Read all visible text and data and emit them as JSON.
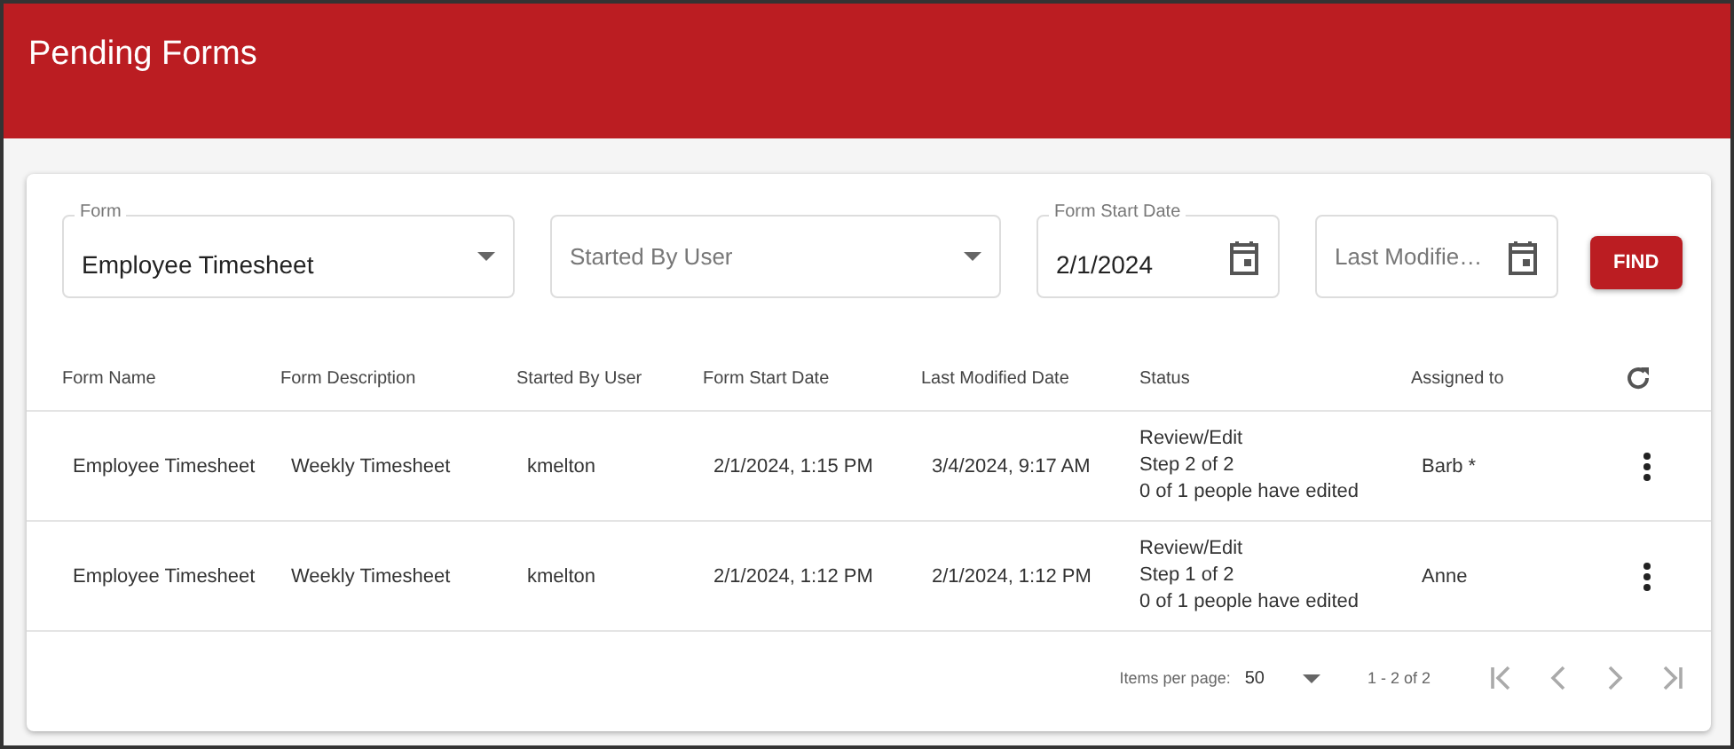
{
  "header": {
    "title": "Pending Forms"
  },
  "filters": [
    {
      "kind": "select",
      "label": "Form",
      "value": "Employee Timesheet"
    },
    {
      "kind": "select",
      "placeholder": "Started By User"
    },
    {
      "kind": "date",
      "label": "Form Start Date",
      "value": "2/1/2024"
    },
    {
      "kind": "date",
      "placeholder": "Last Modifie…"
    }
  ],
  "find_button": "FIND",
  "table": {
    "columns": [
      "Form Name",
      "Form Description",
      "Started By User",
      "Form Start Date",
      "Last Modified Date",
      "Status",
      "Assigned to"
    ],
    "rows": [
      {
        "cells": [
          "Employee Timesheet",
          "Weekly Timesheet",
          "kmelton",
          "2/1/2024, 1:15 PM",
          "3/4/2024, 9:17 AM"
        ],
        "status": [
          "Review/Edit",
          "Step 2 of 2",
          "0 of 1 people have edited"
        ],
        "assigned": "Barb *"
      },
      {
        "cells": [
          "Employee Timesheet",
          "Weekly Timesheet",
          "kmelton",
          "2/1/2024, 1:12 PM",
          "2/1/2024, 1:12 PM"
        ],
        "status": [
          "Review/Edit",
          "Step 1 of 2",
          "0 of 1 people have edited"
        ],
        "assigned": "Anne"
      }
    ]
  },
  "paginator": {
    "items_per_page_label": "Items per page:",
    "page_size": "50",
    "range": "1 - 2 of 2",
    "nav": [
      {
        "kind": "first",
        "disabled": true
      },
      {
        "kind": "prev",
        "disabled": true
      },
      {
        "kind": "next",
        "disabled": true
      },
      {
        "kind": "last",
        "disabled": true
      }
    ]
  }
}
